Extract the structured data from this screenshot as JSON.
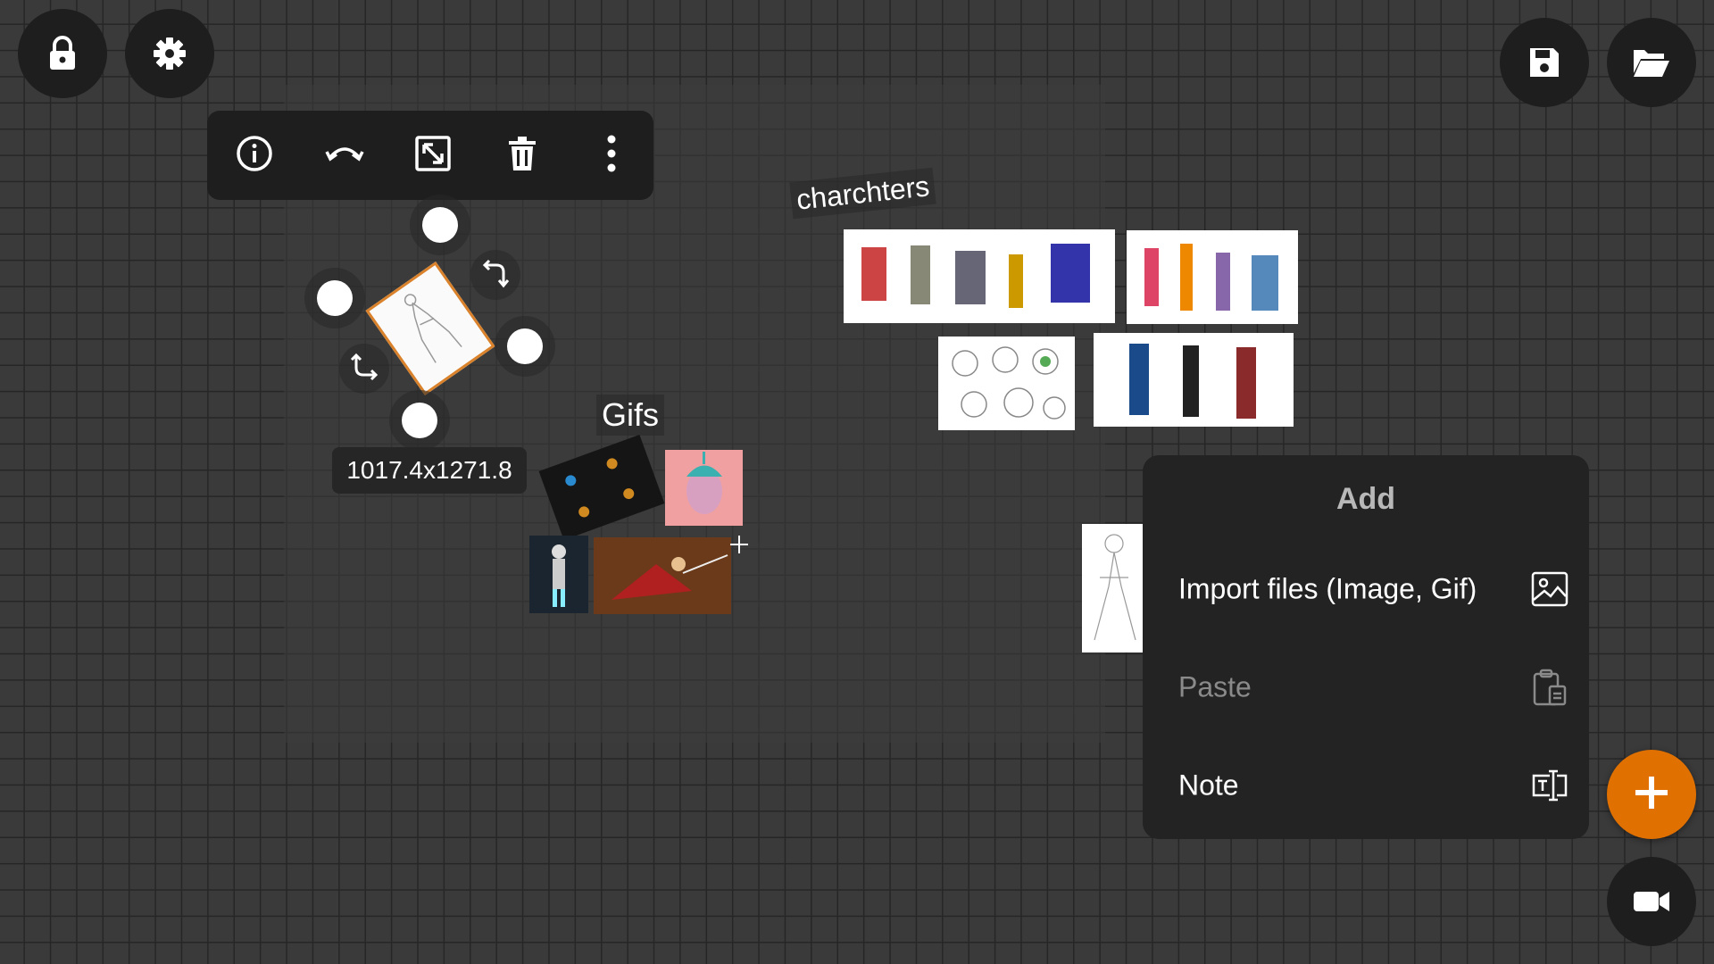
{
  "labels": {
    "charchters": "charchters",
    "gifs": "Gifs",
    "size_readout": "1017.4x1271.8"
  },
  "add_menu": {
    "title": "Add",
    "items": [
      {
        "label": "Import files (Image, Gif)",
        "icon": "image-icon",
        "enabled": true
      },
      {
        "label": "Paste",
        "icon": "clipboard-icon",
        "enabled": false
      },
      {
        "label": "Note",
        "icon": "text-note-icon",
        "enabled": true
      }
    ]
  },
  "toolbar": {
    "items": [
      "info-icon",
      "flip-icon",
      "resize-icon",
      "trash-icon",
      "more-vertical-icon"
    ]
  },
  "top_left": [
    "lock-icon",
    "gear-icon"
  ],
  "top_right": [
    "save-icon",
    "folder-open-icon"
  ],
  "bottom_right": [
    "add-icon",
    "video-camera-icon"
  ],
  "colors": {
    "accent": "#e07000",
    "panel": "#232323",
    "button": "#1e1e1e",
    "disabled_text": "#8a8a8a"
  }
}
